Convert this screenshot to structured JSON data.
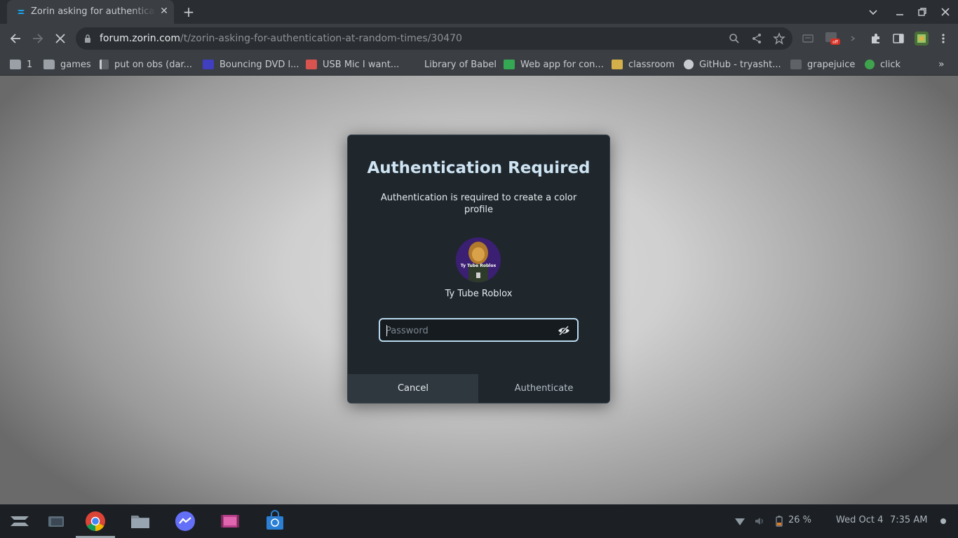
{
  "browser": {
    "tab_title": "Zorin asking for authentication at random times",
    "new_tab_label": "+",
    "url_host": "forum.zorin.com",
    "url_path": "/t/zorin-asking-for-authentication-at-random-times/30470"
  },
  "bookmarks": [
    {
      "label": "1",
      "icon": "folder-icon"
    },
    {
      "label": "games",
      "icon": "folder-icon"
    },
    {
      "label": "put on obs (dar...",
      "icon": "document-icon"
    },
    {
      "label": "Bouncing DVD l...",
      "icon": "dvd-icon"
    },
    {
      "label": "USB Mic I want...",
      "icon": "store-icon"
    },
    {
      "label": "Library of Babel",
      "icon": "blank-icon"
    },
    {
      "label": "Web app for con...",
      "icon": "sheet-icon"
    },
    {
      "label": "classroom",
      "icon": "classroom-icon"
    },
    {
      "label": "GitHub - tryasht...",
      "icon": "github-icon"
    },
    {
      "label": "grapejuice",
      "icon": "apps-icon"
    },
    {
      "label": "click",
      "icon": "circle-icon"
    }
  ],
  "dialog": {
    "title": "Authentication Required",
    "message": "Authentication is required to create a color profile",
    "avatar_caption": "Ty Tube Roblox",
    "username": "Ty Tube Roblox",
    "password_placeholder": "Password",
    "cancel_label": "Cancel",
    "authenticate_label": "Authenticate"
  },
  "taskbar": {
    "apps": [
      "zorin-menu-icon",
      "workspace-icon",
      "chrome-icon",
      "files-icon",
      "messenger-icon",
      "video-icon",
      "store-icon"
    ],
    "battery": "26 %",
    "date": "Wed Oct 4",
    "time": "7:35 AM"
  },
  "colors": {
    "dialog_bg": "#1f272d",
    "title": "#cfe4f3",
    "focus_ring": "#b9d9ee",
    "cancel_bg": "#2f383f"
  }
}
